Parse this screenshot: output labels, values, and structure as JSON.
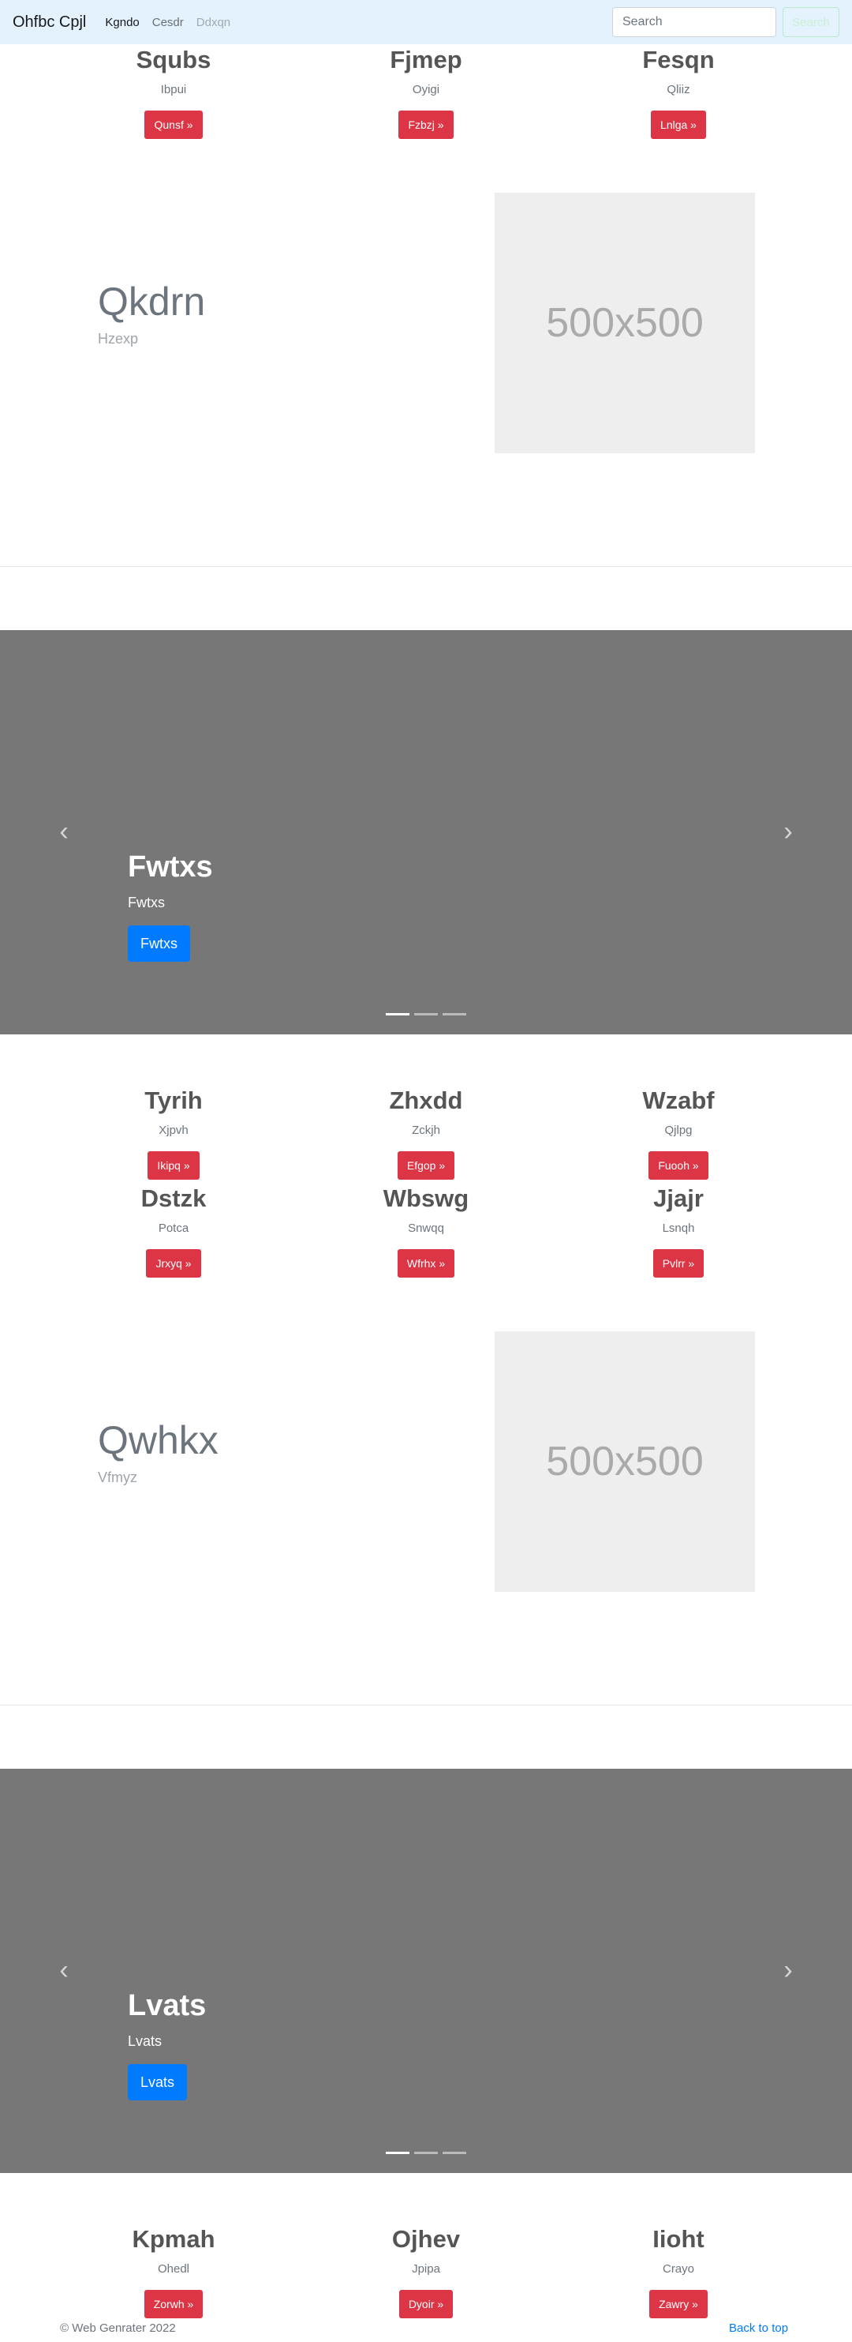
{
  "navbar": {
    "brand": "Ohfbc Cpjl",
    "links": [
      "Kgndo",
      "Cesdr",
      "Ddxqn"
    ],
    "search_placeholder": "Search",
    "search_button": "Search"
  },
  "features_top": [
    {
      "title": "Squbs",
      "text": "Ibpui",
      "button": "Qunsf »"
    },
    {
      "title": "Fjmep",
      "text": "Oyigi",
      "button": "Fzbzj »"
    },
    {
      "title": "Fesqn",
      "text": "Qliiz",
      "button": "Lnlga »"
    }
  ],
  "featurette_1": {
    "heading": "Qkdrn",
    "subheading": "Hzexp",
    "image_label": "500x500"
  },
  "carousel_1": {
    "title": "Fwtxs",
    "text": "Fwtxs",
    "button": "Fwtxs"
  },
  "features_mid_1": [
    {
      "title": "Tyrih",
      "text": "Xjpvh",
      "button": "Ikipq »"
    },
    {
      "title": "Zhxdd",
      "text": "Zckjh",
      "button": "Efgop »"
    },
    {
      "title": "Wzabf",
      "text": "Qjlpg",
      "button": "Fuooh »"
    }
  ],
  "features_mid_2": [
    {
      "title": "Dstzk",
      "text": "Potca",
      "button": "Jrxyq »"
    },
    {
      "title": "Wbswg",
      "text": "Snwqq",
      "button": "Wfrhx »"
    },
    {
      "title": "Jjajr",
      "text": "Lsnqh",
      "button": "Pvlrr »"
    }
  ],
  "featurette_2": {
    "heading": "Qwhkx",
    "subheading": "Vfmyz",
    "image_label": "500x500"
  },
  "carousel_2": {
    "title": "Lvats",
    "text": "Lvats",
    "button": "Lvats"
  },
  "features_bottom": [
    {
      "title": "Kpmah",
      "text": "Ohedl",
      "button": "Zorwh »"
    },
    {
      "title": "Ojhev",
      "text": "Jpipa",
      "button": "Dyoir »"
    },
    {
      "title": "Iioht",
      "text": "Crayo",
      "button": "Zawry »"
    }
  ],
  "footer": {
    "copyright": "© Web Genrater 2022",
    "back_to_top": "Back to top"
  }
}
